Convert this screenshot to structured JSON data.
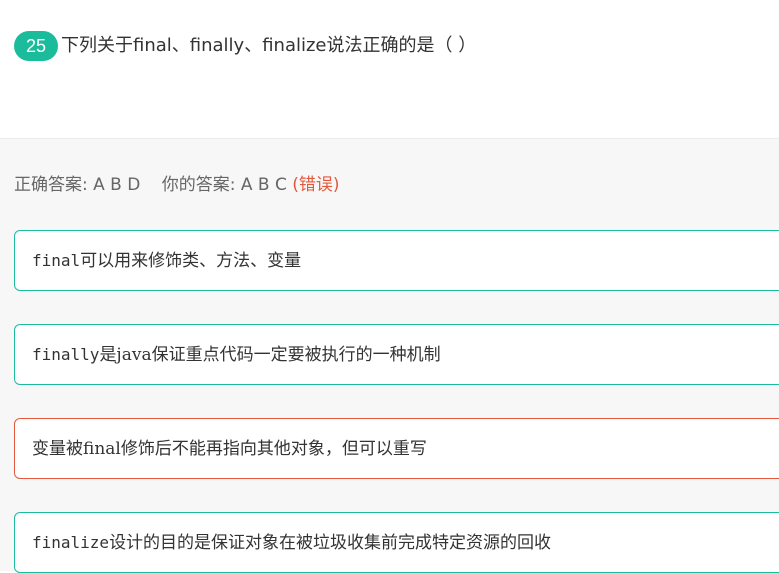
{
  "question": {
    "number": "25",
    "text": "下列关于final、finally、finalize说法正确的是（ ）"
  },
  "answers": {
    "correct_label": "正确答案:",
    "correct_value": "A B D",
    "yours_label": "你的答案:",
    "yours_value": "A B C",
    "status": "(错误)"
  },
  "options": [
    {
      "code": "final",
      "text": "可以用来修饰类、方法、变量",
      "status": "correct"
    },
    {
      "code": "finally",
      "text": "是java保证重点代码一定要被执行的一种机制",
      "status": "correct"
    },
    {
      "code": "",
      "text": "变量被final修饰后不能再指向其他对象，但可以重写",
      "status": "incorrect"
    },
    {
      "code": "finalize",
      "text": "设计的目的是保证对象在被垃圾收集前完成特定资源的回收",
      "status": "correct"
    }
  ],
  "colors": {
    "accent": "#1bbc9b",
    "error": "#e4593d"
  }
}
